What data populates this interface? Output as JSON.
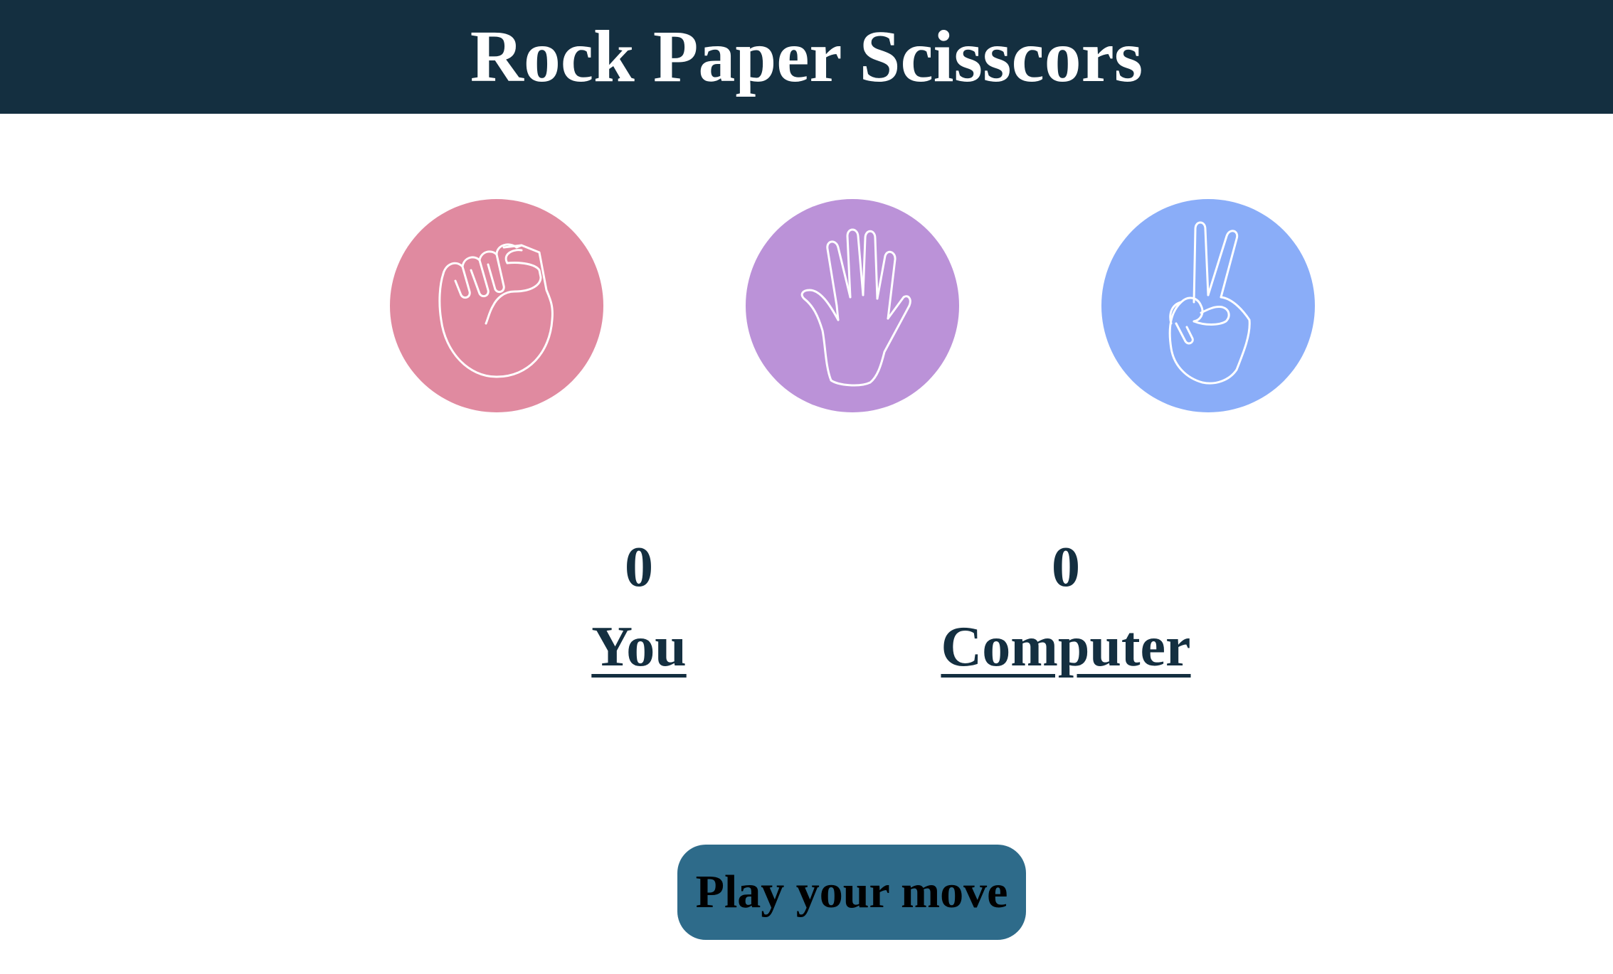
{
  "header": {
    "title": "Rock Paper Scisscors",
    "background": "#142f40"
  },
  "choices": [
    {
      "id": "rock",
      "icon": "rock-fist-icon",
      "color": "#e08aa0"
    },
    {
      "id": "paper",
      "icon": "paper-hand-icon",
      "color": "#bb92d8"
    },
    {
      "id": "scissors",
      "icon": "scissors-victory-icon",
      "color": "#8aadf8"
    }
  ],
  "scoreboard": {
    "user": {
      "score": "0",
      "label": "You"
    },
    "computer": {
      "score": "0",
      "label": "Computer"
    },
    "text_color": "#142f40"
  },
  "action": {
    "play_label": "Play your move",
    "button_color": "#2e6b8a"
  }
}
